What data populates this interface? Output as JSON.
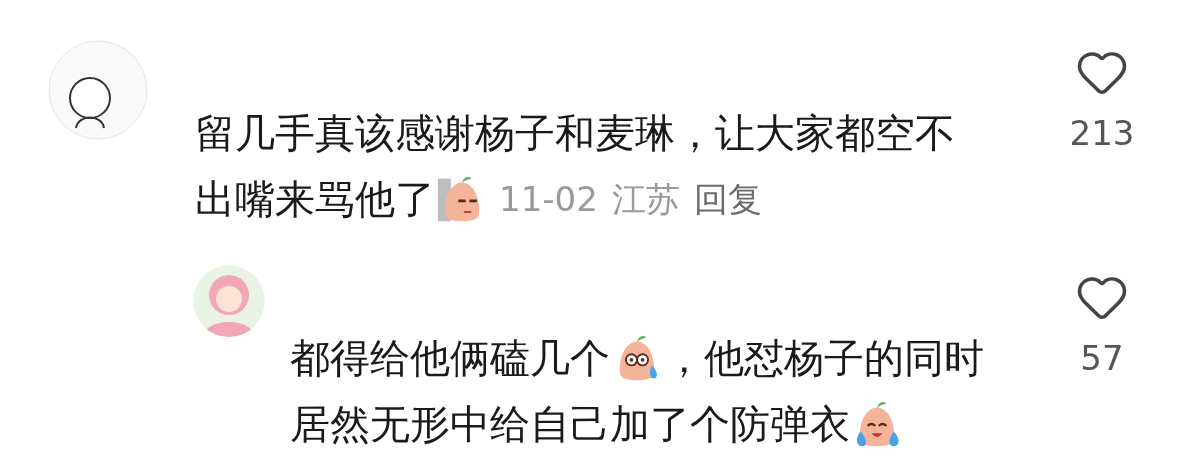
{
  "comments": [
    {
      "indent": false,
      "likes": "213",
      "lines": [
        [
          {
            "kind": "text",
            "text": "留几手真该感谢杨子和麦琳，让大家都空不"
          }
        ],
        [
          {
            "kind": "text",
            "text": "出嘴来骂他了"
          },
          {
            "kind": "peek_sticker"
          }
        ]
      ],
      "date": "11-02",
      "location": "江苏",
      "reply": "回复"
    },
    {
      "indent": true,
      "likes": "57",
      "lines": [
        [
          {
            "kind": "text",
            "text": "都得给他俩磕几个"
          },
          {
            "kind": "sweat_sticker"
          },
          {
            "kind": "text",
            "text": "，他怼杨子的同时"
          }
        ],
        [
          {
            "kind": "text",
            "text": "居然无形中给自己加了个防弹衣"
          },
          {
            "kind": "cry_sticker"
          }
        ]
      ]
    }
  ]
}
